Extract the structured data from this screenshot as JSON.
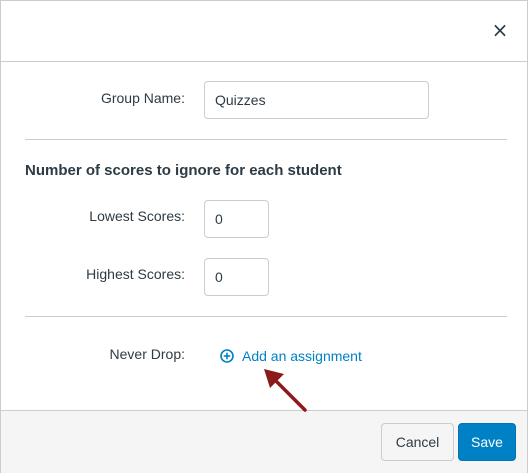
{
  "dialog": {
    "close_label": "×"
  },
  "form": {
    "group_name_label": "Group Name:",
    "group_name_value": "Quizzes",
    "section_title": "Number of scores to ignore for each student",
    "lowest_label": "Lowest Scores:",
    "lowest_value": "0",
    "highest_label": "Highest Scores:",
    "highest_value": "0",
    "never_drop_label": "Never Drop:",
    "add_assignment_label": "Add an assignment"
  },
  "footer": {
    "cancel_label": "Cancel",
    "save_label": "Save"
  },
  "icons": {
    "close": "close-icon",
    "add": "plus-circle-icon",
    "annotation": "arrow-icon"
  },
  "colors": {
    "accent": "#0081c6",
    "annotation_arrow": "#8b1a1a",
    "footer_bg": "#f5f5f5",
    "border": "#c7cdd1"
  }
}
